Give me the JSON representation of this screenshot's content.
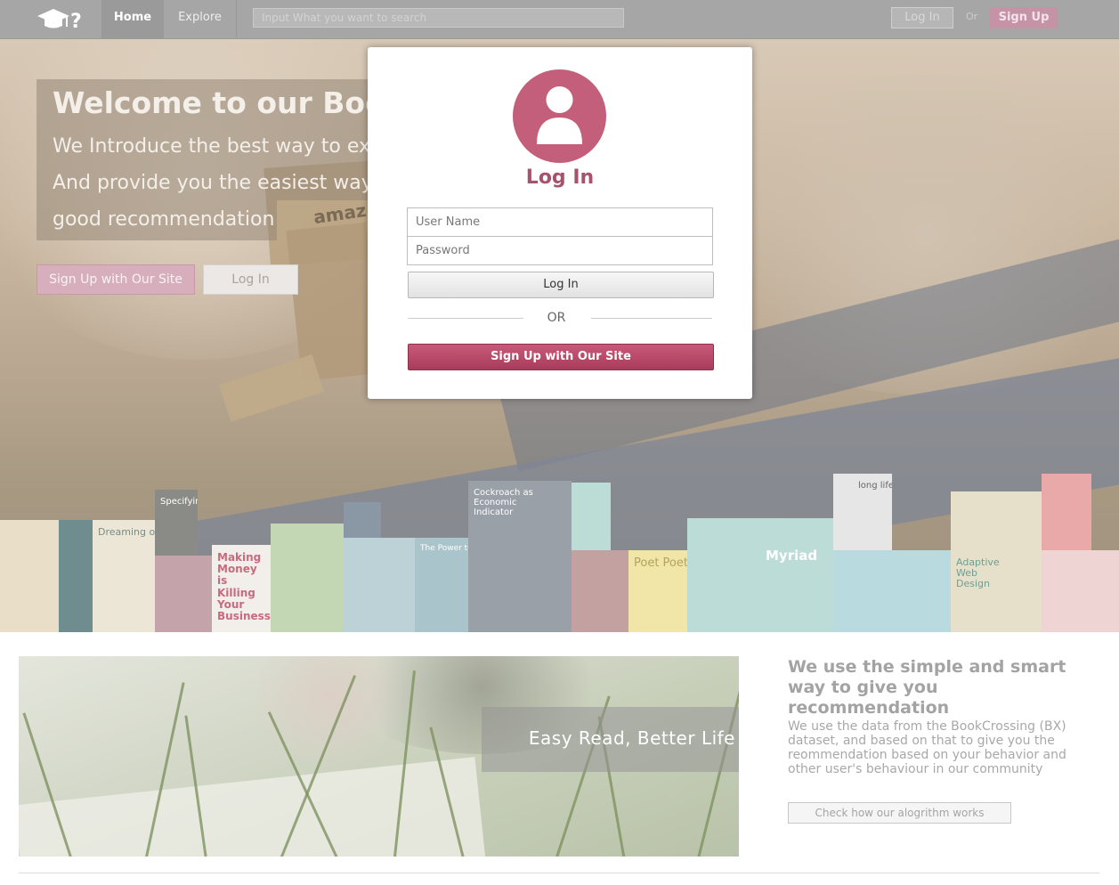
{
  "nav": {
    "logo": "graduation-cap-question-logo",
    "tabs": [
      {
        "label": "Home",
        "active": true
      },
      {
        "label": "Explore",
        "active": false
      }
    ],
    "search_placeholder": "Input What you want to search",
    "login_label": "Log In",
    "or_label": "Or",
    "signup_label": "Sign Up"
  },
  "hero": {
    "title": "Welcome to our Book",
    "line1": "We Introduce the best way to expl",
    "line2": "And provide you the easiest way t",
    "line3": "good recommendation",
    "background_text": "amaz",
    "signup_label": "Sign Up with Our Site",
    "login_label": "Log In"
  },
  "books": [
    {
      "title": "Dreaming of Sweden"
    },
    {
      "title": "Specifying Systems"
    },
    {
      "title": "Making Money is Killing Your Business"
    },
    {
      "title": "The Power to Predict"
    },
    {
      "title": "Cockroach as Economic Indicator"
    },
    {
      "title": "Poet Poet"
    },
    {
      "title": "Myriad"
    },
    {
      "title": "long life"
    },
    {
      "title": "Adaptive Web Design"
    }
  ],
  "modal": {
    "title": "Log In",
    "username_placeholder": "User Name",
    "password_placeholder": "Password",
    "login_label": "Log In",
    "or_label": "OR",
    "signup_label": "Sign Up with Our Site"
  },
  "feature": {
    "caption": "Easy Read, Better Life",
    "side_title": "We use the simple and smart way to give you recommendation",
    "side_text": "We use the data from the BookCrossing (BX) dataset, and based on that to give you the reommendation based on your behavior and other user's behaviour in our community",
    "side_button": "Check how our alogrithm works"
  },
  "colors": {
    "accent": "#c45f7b",
    "accent_dark": "#a6536d",
    "navbar": "#a6a6a6",
    "signup_nav": "#c592a6"
  }
}
